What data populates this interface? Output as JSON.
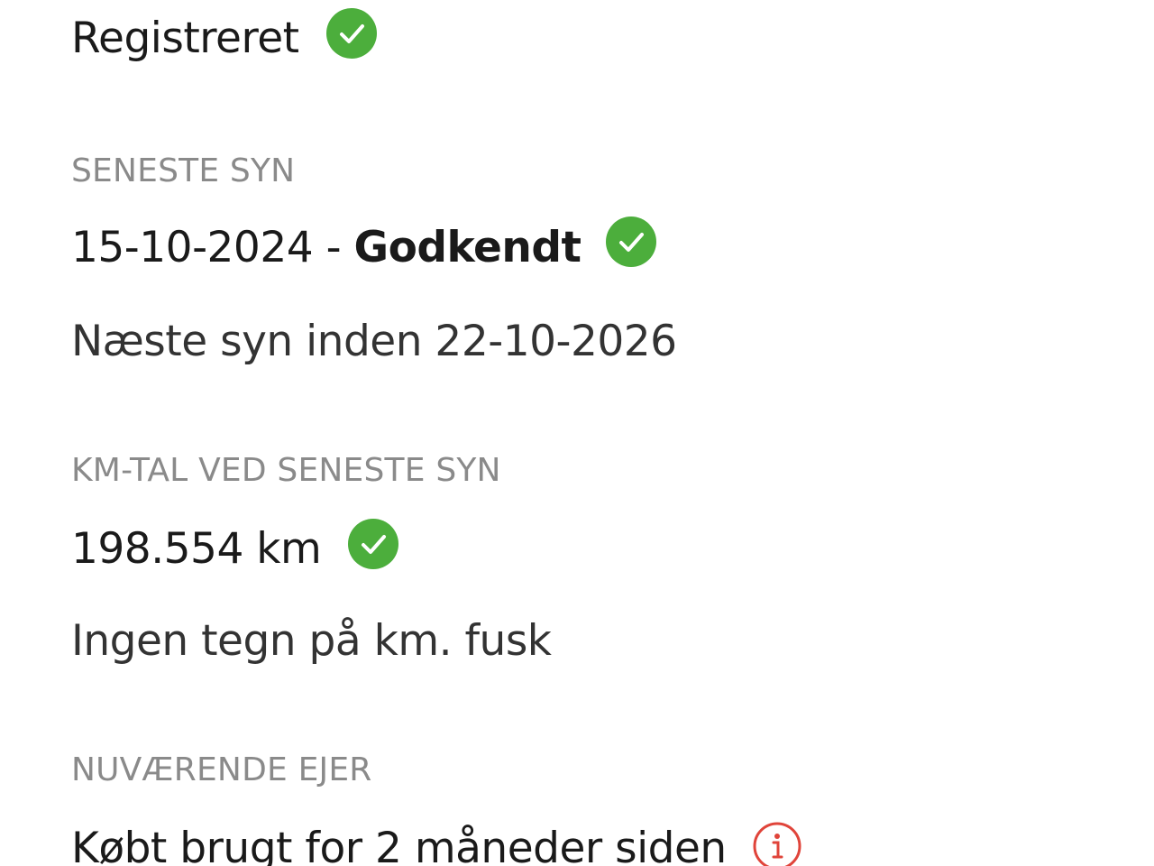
{
  "status": {
    "value": "Registreret",
    "icon": "check-circle-icon",
    "icon_color": "#4cae3c"
  },
  "inspection": {
    "label": "SENESTE SYN",
    "date": "15-10-2024",
    "separator": " - ",
    "result": "Godkendt",
    "icon": "check-circle-icon",
    "next": "Næste syn inden 22-10-2026"
  },
  "mileage": {
    "label": "KM-TAL VED SENESTE SYN",
    "value": "198.554 km",
    "icon": "check-circle-icon",
    "note": "Ingen tegn på km. fusk"
  },
  "owner": {
    "label": "NUVÆRENDE EJER",
    "value": "Købt brugt for 2 måneder siden",
    "icon": "info-icon",
    "icon_color": "#e0443a"
  }
}
